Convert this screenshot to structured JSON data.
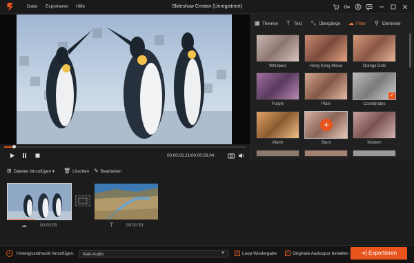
{
  "titlebar": {
    "title": "Slideshow Creator (Unregistriert)",
    "menu": [
      "Datei",
      "Exportieren",
      "Hilfe"
    ],
    "icons": [
      "cart-icon",
      "key-icon",
      "account-icon",
      "feedback-icon",
      "minimize-icon",
      "maximize-icon",
      "close-icon"
    ]
  },
  "player": {
    "time": "00:00:02.21/00:00:58.04",
    "progress": 0.04
  },
  "tabs": [
    {
      "label": "Themen",
      "icon": "grid-icon"
    },
    {
      "label": "Text",
      "icon": "text-icon"
    },
    {
      "label": "Übergänge",
      "icon": "transition-icon"
    },
    {
      "label": "Filter",
      "icon": "filter-icon",
      "active": true
    },
    {
      "label": "Elemente",
      "icon": "elements-icon"
    }
  ],
  "filters": [
    {
      "name": "Whirlpool"
    },
    {
      "name": "Hong Kong Movie"
    },
    {
      "name": "Orange Dots"
    },
    {
      "name": "Purple"
    },
    {
      "name": "Plain"
    },
    {
      "name": "Coordinates"
    },
    {
      "name": "Warm"
    },
    {
      "name": "Stars"
    },
    {
      "name": "Modern"
    }
  ],
  "toolbar": {
    "add_files": "Dateien hinzufügen",
    "delete": "Löschen",
    "edit": "Bearbeiten"
  },
  "clips": [
    {
      "duration": "00:00:05"
    },
    {
      "duration": "00:00:53"
    }
  ],
  "bottom": {
    "bg_music_label": "Hintergrundmusik hinzufügen:",
    "audio_value": "Kein Audio",
    "loop_label": "Loop-Wiedergabe",
    "keep_audio_label": "Originale Audiospur behalten",
    "export_label": "Exportieren"
  },
  "colors": {
    "accent": "#e8541c"
  }
}
